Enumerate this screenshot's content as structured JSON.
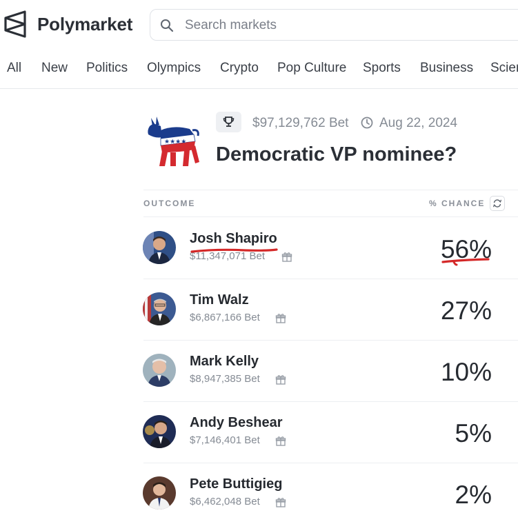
{
  "brand": {
    "name": "Polymarket",
    "logo_icon": "polymarket-logo-icon"
  },
  "search": {
    "placeholder": "Search markets",
    "value": ""
  },
  "nav": {
    "items": [
      {
        "label": "All"
      },
      {
        "label": "New"
      },
      {
        "label": "Politics"
      },
      {
        "label": "Olympics"
      },
      {
        "label": "Crypto"
      },
      {
        "label": "Pop Culture"
      },
      {
        "label": "Sports"
      },
      {
        "label": "Business"
      },
      {
        "label": "Scier"
      }
    ]
  },
  "event": {
    "icon": "democrat-donkey-icon",
    "volume": "$97,129,762 Bet",
    "end_date": "Aug 22, 2024",
    "title": "Democratic VP nominee?"
  },
  "table": {
    "col_outcome": "OUTCOME",
    "col_chance": "% CHANCE",
    "rows": [
      {
        "name": "Josh Shapiro",
        "bet": "$11,347,071 Bet",
        "chance": "56%",
        "highlighted": true
      },
      {
        "name": "Tim Walz",
        "bet": "$6,867,166 Bet",
        "chance": "27%"
      },
      {
        "name": "Mark Kelly",
        "bet": "$8,947,385 Bet",
        "chance": "10%"
      },
      {
        "name": "Andy Beshear",
        "bet": "$7,146,401 Bet",
        "chance": "5%"
      },
      {
        "name": "Pete Buttigieg",
        "bet": "$6,462,048 Bet",
        "chance": "2%"
      }
    ]
  },
  "colors": {
    "annotation_red": "#d42828",
    "text_primary": "#262a30",
    "text_muted": "#858b94"
  }
}
